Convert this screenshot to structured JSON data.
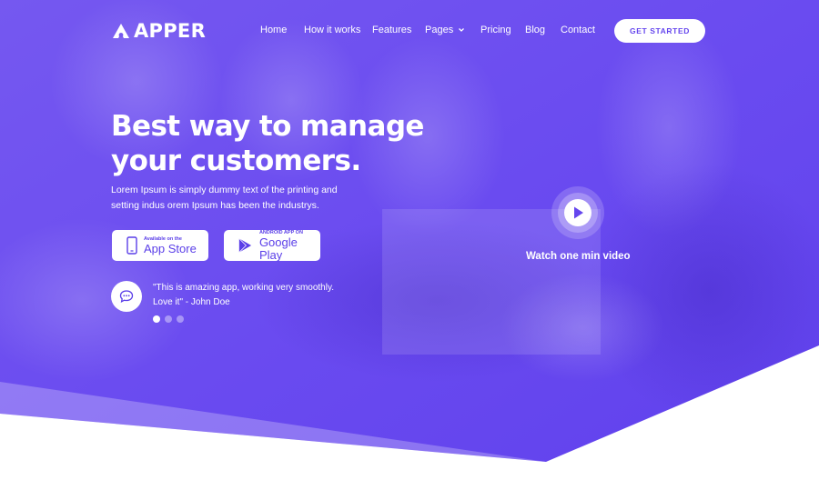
{
  "brand": {
    "name": "APPER",
    "logo_icon": "triangle-a-icon"
  },
  "nav": {
    "items": [
      {
        "label": "Home"
      },
      {
        "label": "How it works"
      },
      {
        "label": "Features"
      },
      {
        "label": "Pages",
        "has_dropdown": true
      },
      {
        "label": "Pricing"
      },
      {
        "label": "Blog"
      },
      {
        "label": "Contact"
      }
    ],
    "cta_label": "GET STARTED"
  },
  "hero": {
    "headline_line1": "Best way to manage",
    "headline_line2": "your customers.",
    "subtext": "Lorem Ipsum is simply dummy text of the printing and setting indus orem Ipsum has been the industrys.",
    "app_store": {
      "small": "Available on the",
      "big": "App Store",
      "icon": "phone-icon"
    },
    "google_play": {
      "small": "ANDROID APP ON",
      "big": "Google Play",
      "icon": "play-store-icon"
    },
    "testimonial": {
      "icon": "chat-bubble-icon",
      "quote": "\"This is amazing app, working very smoothly. Love it\" - John Doe",
      "active_slide": 1,
      "slide_count": 3
    },
    "video": {
      "label": "Watch one min video",
      "icon": "play-icon"
    }
  },
  "colors": {
    "primary": "#6546ee",
    "overlay": "#6a4cf2",
    "text": "#ffffff"
  }
}
